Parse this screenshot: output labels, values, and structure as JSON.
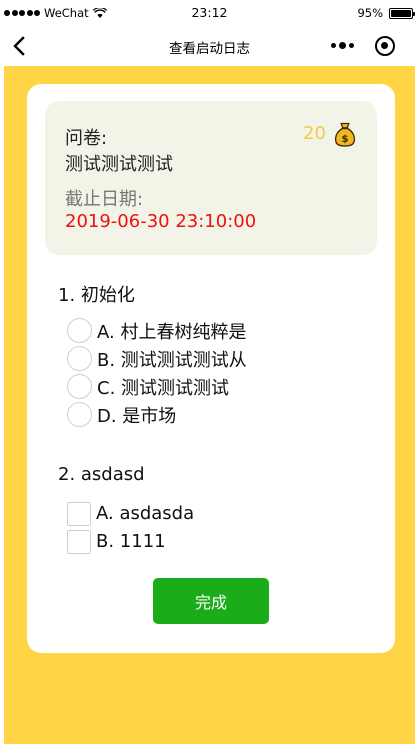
{
  "status_bar": {
    "carrier": "WeChat",
    "time": "23:12",
    "battery": "95%"
  },
  "nav": {
    "title": "查看启动日志"
  },
  "survey": {
    "label": "问卷:",
    "name": "测试测试测试",
    "points": "20",
    "deadline_label": "截止日期:",
    "deadline": "2019-06-30 23:10:00"
  },
  "questions": [
    {
      "title": "1. 初始化",
      "type": "radio",
      "options": [
        "A. 村上春树纯粹是",
        "B. 测试测试测试从",
        "C. 测试测试测试",
        "D. 是市场"
      ]
    },
    {
      "title": "2. asdasd",
      "type": "checkbox",
      "options": [
        "A. asdasda",
        "B. 1111"
      ]
    }
  ],
  "submit_label": "完成",
  "colors": {
    "page_background": "#ffd545",
    "info_box": "#f2f4e8",
    "deadline": "#ee1111",
    "points": "#f5c84c",
    "button": "#1aad19"
  }
}
